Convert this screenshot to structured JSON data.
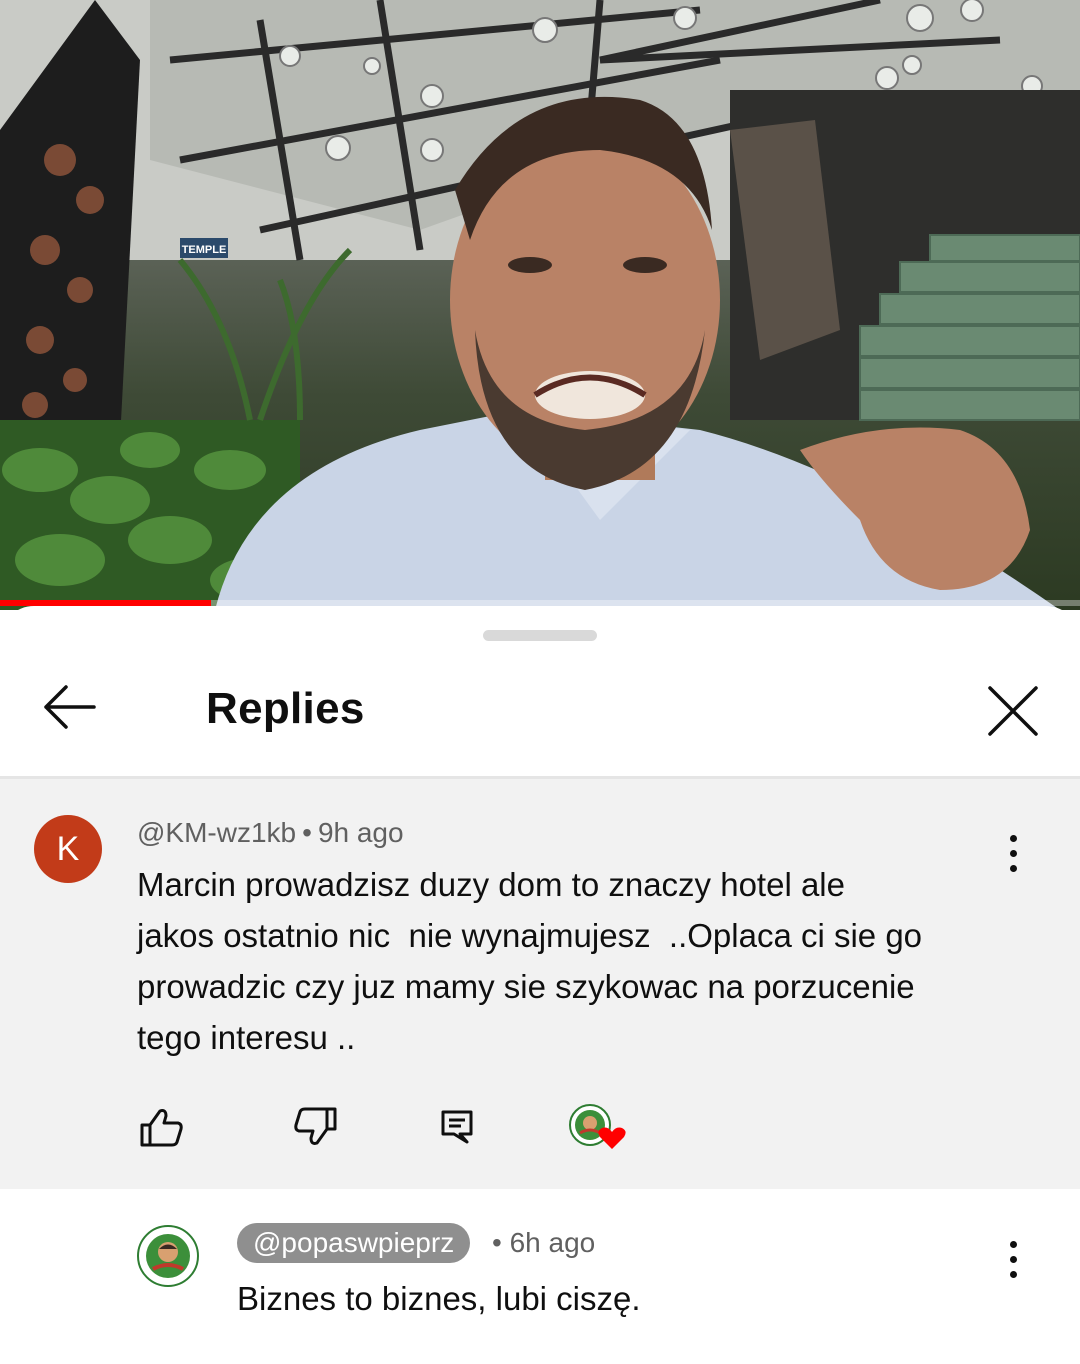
{
  "video": {
    "scene_label": "video-frame",
    "sign_text": "TEMPLE",
    "progress_fraction": 0.195
  },
  "sheet": {
    "title": "Replies",
    "back_icon": "arrow-left-icon",
    "close_icon": "close-icon"
  },
  "parent_comment": {
    "avatar_letter": "K",
    "avatar_color": "#c23b19",
    "author": "@KM-wz1kb",
    "separator": "•",
    "time": "9h ago",
    "text": "Marcin prowadzisz duzy dom to znaczy hotel ale\njakos ostatnio nic  nie wynajmujesz  ..Oplaca ci sie go\nprowadzic czy juz mamy sie szykowac na porzucenie\ntego interesu ..",
    "actions": [
      "like-icon",
      "dislike-icon",
      "reply-icon",
      "creator-heart-icon"
    ],
    "heart_color": "#ff0000"
  },
  "reply": {
    "author": "@popaswpieprz",
    "separator": "•",
    "time": "6h ago",
    "text": "Biznes to biznes, lubi ciszę."
  },
  "colors": {
    "accent": "#ff0000",
    "secondary_text": "#606060",
    "parent_bg": "#f2f2f2",
    "chip_bg": "#8f8f8f"
  }
}
